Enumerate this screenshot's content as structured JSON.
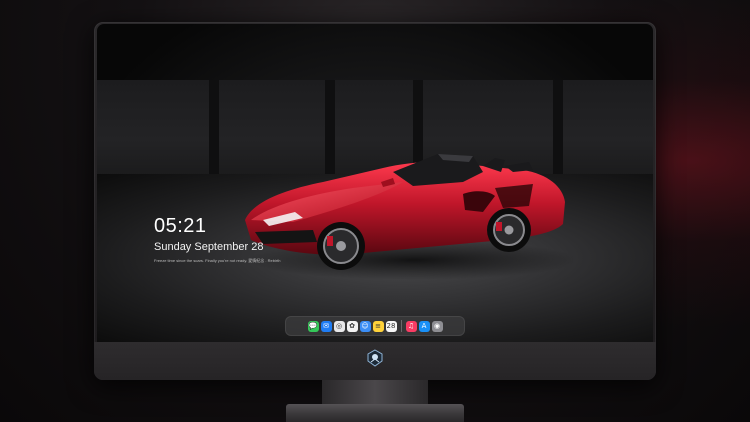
{
  "lockscreen": {
    "time": "05:21",
    "date": "Sunday September  28",
    "tagline": "Freeze time since the scars. Finally you're not ready. 愛情紀念 . Rebirth"
  },
  "wallpaper": {
    "subject": "red convertible sports car in garage",
    "car_color": "#c0162a"
  },
  "dock": {
    "apps": [
      {
        "name": "messages-icon",
        "color": "#35c759",
        "glyph": "💬"
      },
      {
        "name": "mail-icon",
        "color": "#1f7cf3",
        "glyph": "✉"
      },
      {
        "name": "safari-icon",
        "color": "#e9e9ea",
        "glyph": "◎"
      },
      {
        "name": "photos-icon",
        "color": "#f2f2f2",
        "glyph": "✿"
      },
      {
        "name": "finder-icon",
        "color": "#3b8ef6",
        "glyph": "☺"
      },
      {
        "name": "notes-icon",
        "color": "#ffd23a",
        "glyph": "≡"
      },
      {
        "name": "calendar-icon",
        "color": "#f7f7f7",
        "glyph": "28"
      },
      {
        "name": "music-icon",
        "color": "#fa3c64",
        "glyph": "♫"
      },
      {
        "name": "appstore-icon",
        "color": "#1990f8",
        "glyph": "A"
      },
      {
        "name": "camera-icon",
        "color": "#8e8e93",
        "glyph": "◉"
      }
    ]
  },
  "colors": {
    "bezel": "#2b292b",
    "accent_red": "#c0162a"
  }
}
